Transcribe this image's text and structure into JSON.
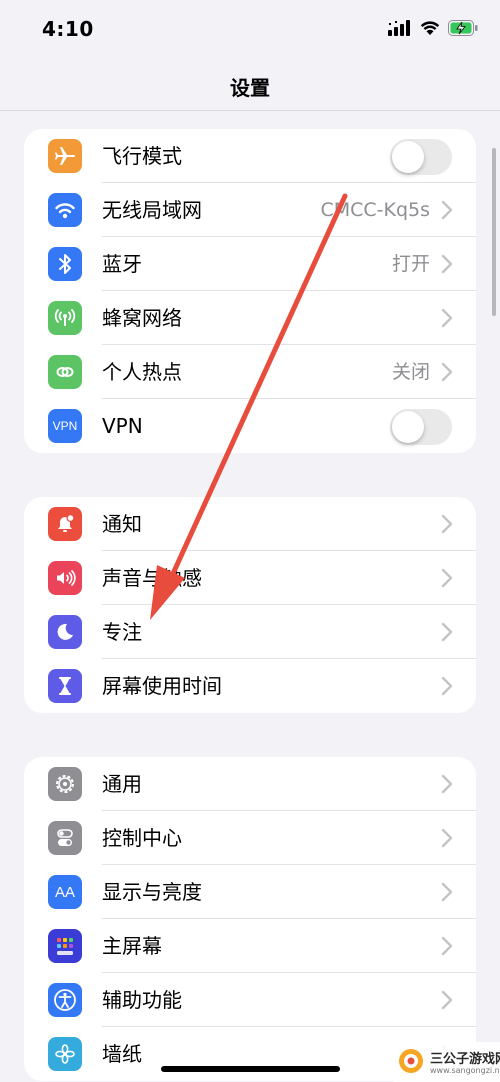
{
  "status_bar": {
    "time": "4:10"
  },
  "nav": {
    "title": "设置"
  },
  "groups": [
    {
      "items": [
        {
          "label": "飞行模式",
          "icon": "airplane-icon",
          "color": "#f19a37",
          "control": "toggle",
          "state": "off"
        },
        {
          "label": "无线局域网",
          "icon": "wifi-icon",
          "color": "#3478f6",
          "value": "CMCC-Kq5s"
        },
        {
          "label": "蓝牙",
          "icon": "bluetooth-icon",
          "color": "#3478f6",
          "value": "打开"
        },
        {
          "label": "蜂窝网络",
          "icon": "cellular-icon",
          "color": "#5dc466"
        },
        {
          "label": "个人热点",
          "icon": "hotspot-icon",
          "color": "#5dc466",
          "value": "关闭"
        },
        {
          "label": "VPN",
          "icon": "vpn-icon",
          "icon_text": "VPN",
          "color": "#3478f6",
          "control": "toggle",
          "state": "off"
        }
      ]
    },
    {
      "items": [
        {
          "label": "通知",
          "icon": "notifications-icon",
          "color": "#eb4e3d"
        },
        {
          "label": "声音与触感",
          "icon": "sound-icon",
          "color": "#eb445a"
        },
        {
          "label": "专注",
          "icon": "focus-moon-icon",
          "color": "#5e5ce6"
        },
        {
          "label": "屏幕使用时间",
          "icon": "hourglass-icon",
          "color": "#5e5ce6"
        }
      ]
    },
    {
      "items": [
        {
          "label": "通用",
          "icon": "gear-icon",
          "color": "#8e8e93"
        },
        {
          "label": "控制中心",
          "icon": "control-center-icon",
          "color": "#8e8e93"
        },
        {
          "label": "显示与亮度",
          "icon": "display-brightness-icon",
          "icon_text": "AA",
          "color": "#3478f6"
        },
        {
          "label": "主屏幕",
          "icon": "home-screen-icon",
          "color": "#3b3bd6"
        },
        {
          "label": "辅助功能",
          "icon": "accessibility-icon",
          "color": "#3478f6"
        },
        {
          "label": "墙纸",
          "icon": "wallpaper-icon",
          "color": "#35aadc"
        }
      ]
    }
  ],
  "annotation": {
    "color": "#e74c3c",
    "points_to": "专注"
  },
  "watermark": {
    "name": "三公子游戏网",
    "url": "www.sangongzi.net"
  }
}
